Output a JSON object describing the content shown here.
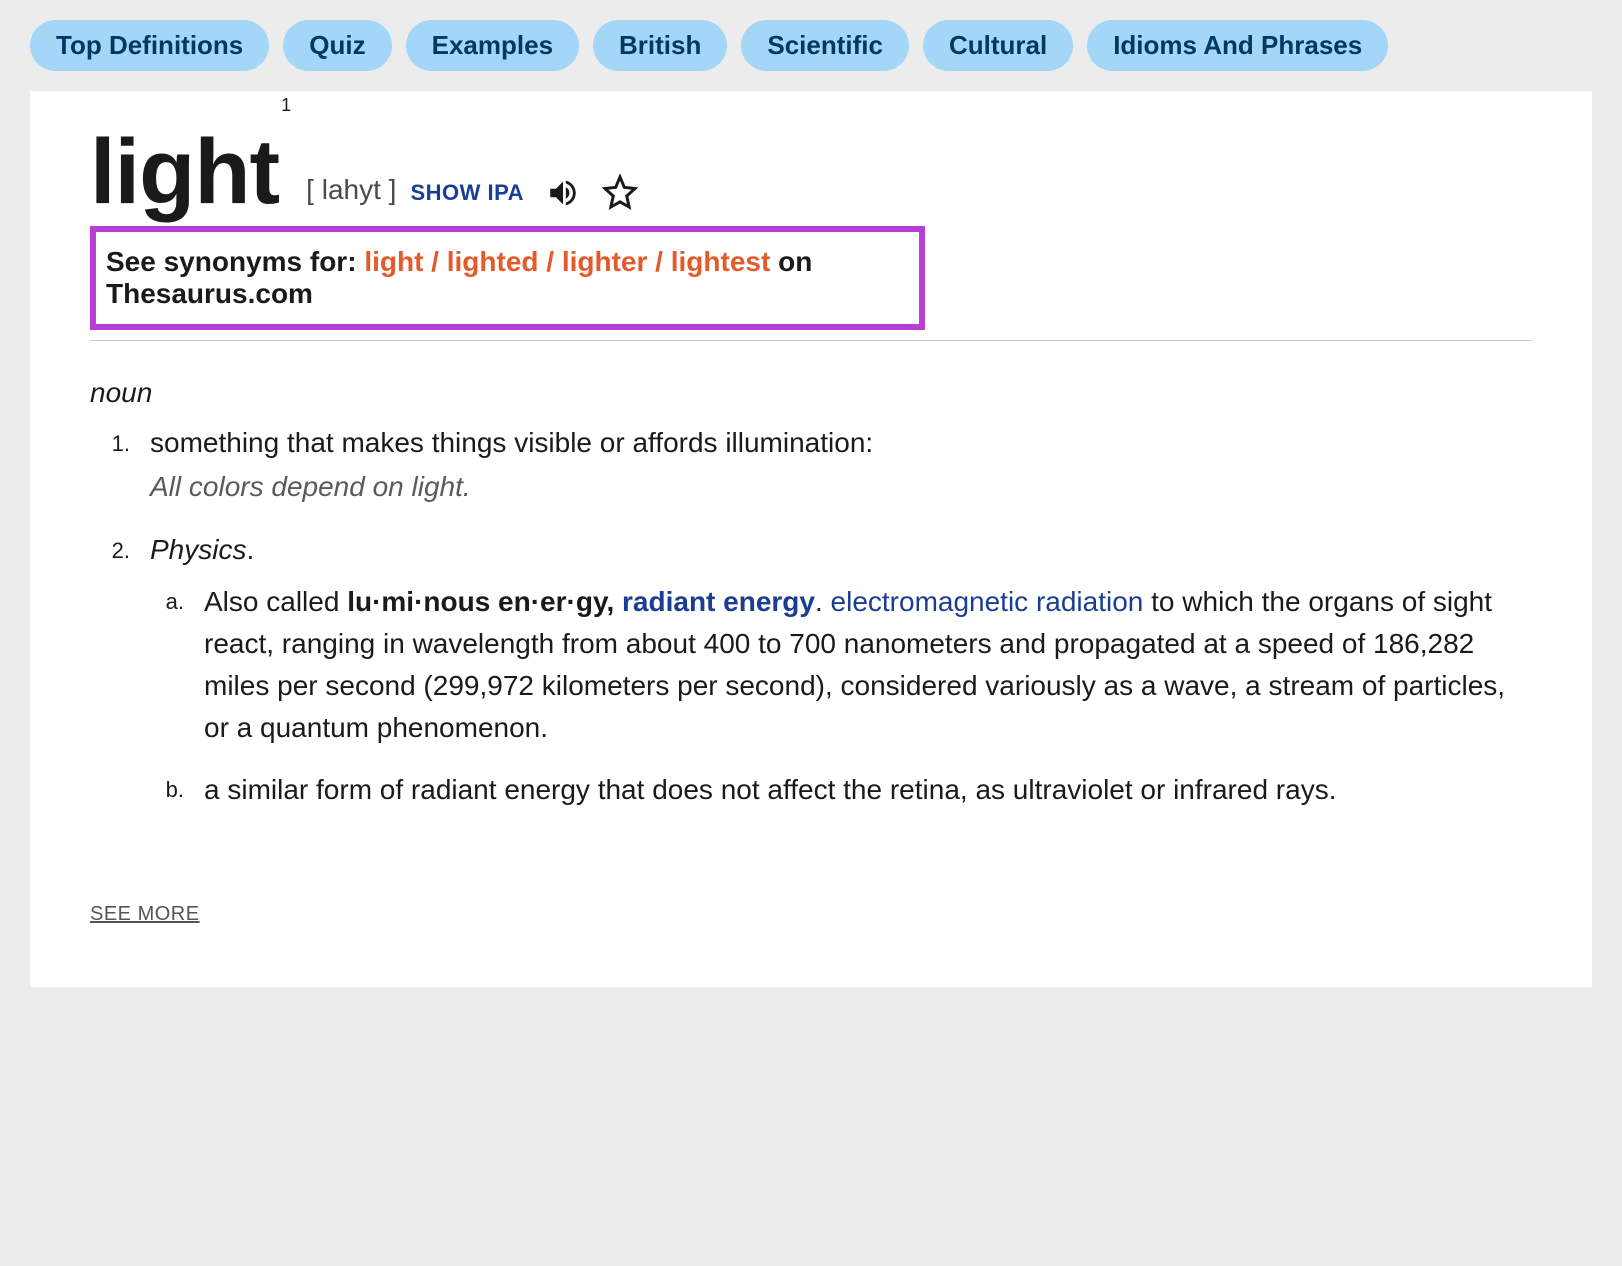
{
  "tabs": {
    "top_definitions": "Top Definitions",
    "quiz": "Quiz",
    "examples": "Examples",
    "british": "British",
    "scientific": "Scientific",
    "cultural": "Cultural",
    "idioms": "Idioms And Phrases"
  },
  "entry": {
    "headword": "light",
    "homograph_number": "1",
    "pronunciation": "[ lahyt ]",
    "show_ipa": "SHOW IPA",
    "synonyms": {
      "prefix": "See synonyms for: ",
      "links": "light / lighted / lighter / lightest",
      "suffix": " on Thesaurus.com"
    },
    "pos": "noun",
    "definitions": {
      "d1": {
        "num": "1.",
        "text": "something that makes things visible or affords illumination:",
        "example": "All colors depend on light."
      },
      "d2": {
        "num": "2.",
        "domain": "Physics",
        "period": ".",
        "a": {
          "num": "a.",
          "prefix": "Also called ",
          "term": "lu·mi·nous en·er·gy, ",
          "link1": "radiant energy",
          "dot": ". ",
          "link2": "electromagnetic radiation",
          "rest": " to which the organs of sight react, ranging in wavelength from about 400 to 700 nanometers and propagated at a speed of 186,282 miles per second (299,972 kilometers per second), considered variously as a wave, a stream of particles, or a quantum phenomenon."
        },
        "b": {
          "num": "b.",
          "text": "a similar form of radiant energy that does not affect the retina, as ultraviolet or infrared rays."
        }
      }
    },
    "see_more": "SEE MORE"
  }
}
